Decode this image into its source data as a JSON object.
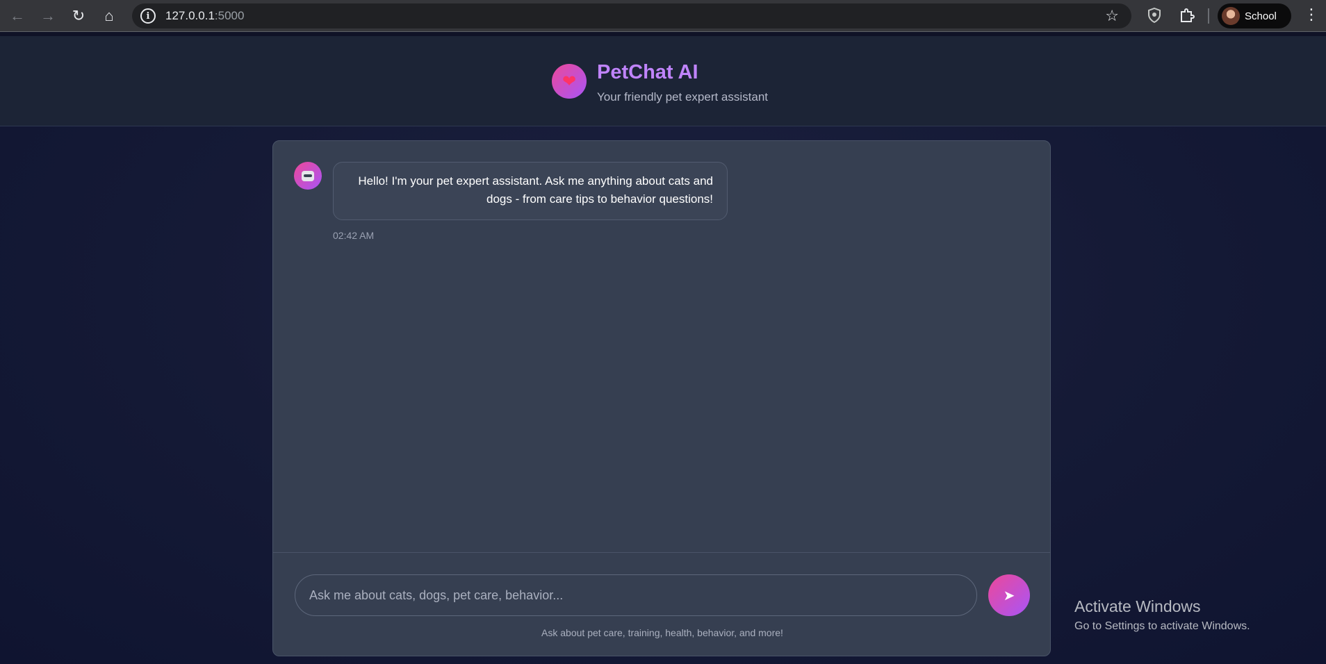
{
  "browser": {
    "back_icon": "←",
    "forward_icon": "→",
    "reload_icon": "↻",
    "home_icon": "⌂",
    "url_host": "127.0.0.1",
    "url_port": ":5000",
    "star_icon": "☆",
    "profile_name": "School",
    "menu_icon": "⋮"
  },
  "header": {
    "logo_icon": "❤",
    "title": "PetChat AI",
    "subtitle": "Your friendly pet expert assistant"
  },
  "chat": {
    "messages": [
      {
        "sender": "bot",
        "text": "Hello! I'm your pet expert assistant. Ask me anything about cats and dogs - from care tips to behavior questions!",
        "time": "02:42 AM"
      }
    ]
  },
  "composer": {
    "placeholder": "Ask me about cats, dogs, pet care, behavior...",
    "send_icon": "➤",
    "hint": "Ask about pet care, training, health, behavior, and more!"
  },
  "watermark": {
    "title": "Activate Windows",
    "subtitle": "Go to Settings to activate Windows."
  },
  "colors": {
    "accent_start": "#ec4899",
    "accent_end": "#a855f7",
    "title": "#c084fc",
    "card": "#363f51"
  }
}
